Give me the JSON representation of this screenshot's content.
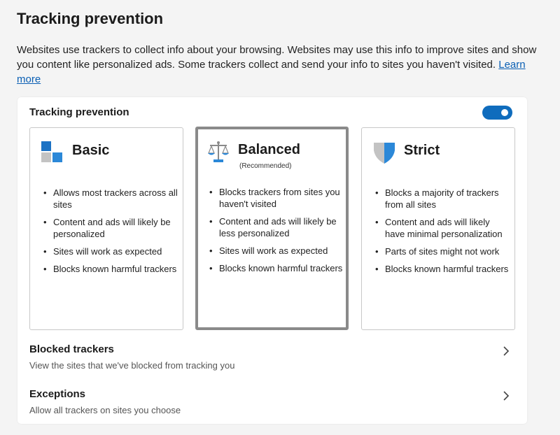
{
  "page": {
    "title": "Tracking prevention",
    "description": "Websites use trackers to collect info about your browsing. Websites may use this info to improve sites and show you content like personalized ads. Some trackers collect and send your info to sites you haven't visited.",
    "learn_more": "Learn more"
  },
  "panel": {
    "title": "Tracking prevention",
    "toggle_on": true,
    "accent_color": "#0f6cbd",
    "cards": [
      {
        "name": "Basic",
        "subtitle": "",
        "icon": "squares-icon",
        "selected": false,
        "bullets": [
          "Allows most trackers across all sites",
          "Content and ads will likely be personalized",
          "Sites will work as expected",
          "Blocks known harmful trackers"
        ]
      },
      {
        "name": "Balanced",
        "subtitle": "(Recommended)",
        "icon": "scales-icon",
        "selected": true,
        "bullets": [
          "Blocks trackers from sites you haven't visited",
          "Content and ads will likely be less personalized",
          "Sites will work as expected",
          "Blocks known harmful trackers"
        ]
      },
      {
        "name": "Strict",
        "subtitle": "",
        "icon": "shield-icon",
        "selected": false,
        "bullets": [
          "Blocks a majority of trackers from all sites",
          "Content and ads will likely have minimal personalization",
          "Parts of sites might not work",
          "Blocks known harmful trackers"
        ]
      }
    ]
  },
  "blocked_trackers": {
    "title": "Blocked trackers",
    "subtitle": "View the sites that we've blocked from tracking you"
  },
  "exceptions": {
    "title": "Exceptions",
    "subtitle": "Allow all trackers on sites you choose"
  }
}
